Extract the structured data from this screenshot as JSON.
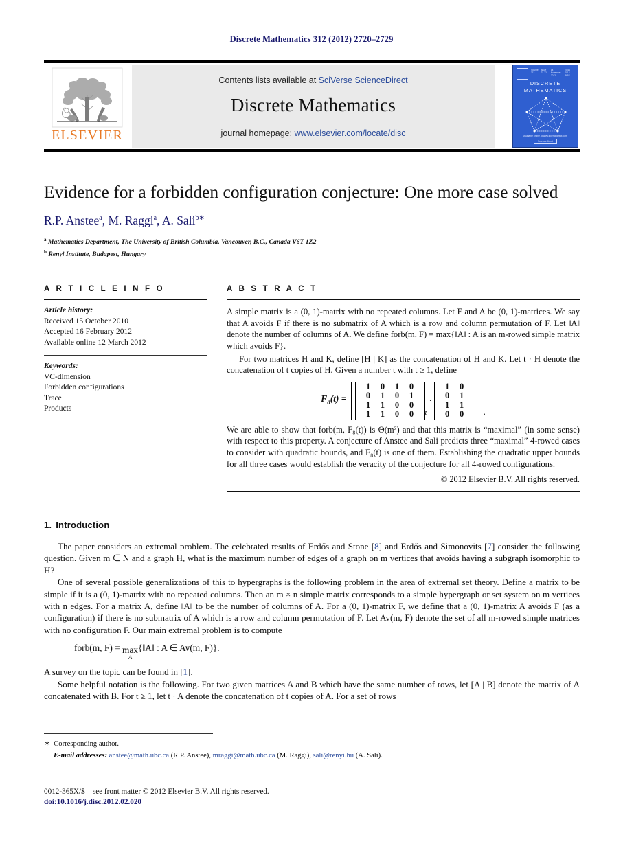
{
  "running_head": "Discrete Mathematics 312 (2012) 2720–2729",
  "masthead": {
    "contents_prefix": "Contents lists available at ",
    "contents_link": "SciVerse ScienceDirect",
    "journal_title": "Discrete Mathematics",
    "homepage_prefix": "journal homepage: ",
    "homepage_link": "www.elsevier.com/locate/disc",
    "publisher_wordmark": "ELSEVIER",
    "publisher_color": "#E87722"
  },
  "cover": {
    "title_line1": "DISCRETE",
    "title_line2": "MATHEMATICS",
    "header_items": [
      "Volume 312",
      "Issue 21-22",
      "14 November 2012",
      "ISSN 0012-365X"
    ],
    "footer_note": "Available online at www.sciencedirect.com",
    "footer_badge": "ScienceDirect",
    "background_color": "#2f5fd0"
  },
  "article": {
    "title": "Evidence for a forbidden configuration conjecture: One more case solved",
    "authors": [
      {
        "name": "R.P. Anstee",
        "marks": "a"
      },
      {
        "name": "M. Raggi",
        "marks": "a"
      },
      {
        "name": "A. Sali",
        "marks": "b∗"
      }
    ],
    "author_color": "#1a1a6e",
    "affiliations": [
      {
        "mark": "a",
        "text": "Mathematics Department, The University of British Columbia, Vancouver, B.C., Canada V6T 1Z2"
      },
      {
        "mark": "b",
        "text": "Renyi Institute, Budapest, Hungary"
      }
    ]
  },
  "info": {
    "heading": "A R T I C L E   I N F O",
    "history_label": "Article history:",
    "history": [
      "Received 15 October 2010",
      "Accepted 16 February 2012",
      "Available online 12 March 2012"
    ],
    "keywords_label": "Keywords:",
    "keywords": [
      "VC-dimension",
      "Forbidden configurations",
      "Trace",
      "Products"
    ]
  },
  "abstract": {
    "heading": "A B S T R A C T",
    "para1": "A simple matrix is a (0, 1)-matrix with no repeated columns. Let F and A be (0, 1)-matrices. We say that A avoids F if there is no submatrix of A which is a row and column permutation of F. Let ‖A‖ denote the number of columns of A. We define forb(m, F) = max{‖A‖ : A is an m-rowed simple matrix which avoids F}.",
    "para2": "For two matrices H and K, define [H | K] as the concatenation of H and K. Let t · H denote the concatenation of t copies of H. Given a number t with t ≥ 1, define",
    "equation": {
      "lead": "F",
      "lead_sub": "8",
      "lead_arg": "(t) =",
      "left_matrix": [
        [
          1,
          0,
          1,
          0
        ],
        [
          0,
          1,
          0,
          1
        ],
        [
          1,
          1,
          0,
          0
        ],
        [
          1,
          1,
          0,
          0
        ]
      ],
      "exponent": "t",
      "operator": "·",
      "right_matrix": [
        [
          1,
          0
        ],
        [
          0,
          1
        ],
        [
          1,
          1
        ],
        [
          0,
          0
        ]
      ],
      "tail": "."
    },
    "para3": "We are able to show that forb(m, F₈(t)) is Θ(m²) and that this matrix is “maximal” (in some sense) with respect to this property. A conjecture of Anstee and Sali predicts three “maximal” 4-rowed cases to consider with quadratic bounds, and F₈(t) is one of them. Establishing the quadratic upper bounds for all three cases would establish the veracity of the conjecture for all 4-rowed configurations.",
    "copyright": "© 2012 Elsevier B.V. All rights reserved."
  },
  "introduction": {
    "number": "1.",
    "heading": "Introduction",
    "para1_a": "The paper considers an extremal problem. The celebrated results of  Erdős and Stone [",
    "cite1": "8",
    "para1_b": "] and Erdős and Simonovits [",
    "cite2": "7",
    "para1_c": "] consider the following question. Given m ∈ N and a graph H, what is the maximum number of edges of a graph on m vertices that avoids having a subgraph isomorphic to H?",
    "para2": "One of several possible generalizations of this to hypergraphs is the following problem in the area of extremal set theory. Define a matrix to be simple if it is a (0, 1)-matrix with no repeated columns. Then an m × n simple matrix corresponds to a simple hypergraph or set system on m vertices with n edges. For a matrix A, define ‖A‖ to be the number of columns of A. For a (0, 1)-matrix F, we define that a (0, 1)-matrix A avoids F (as a configuration) if there is no submatrix of A which is a row and column permutation of F. Let Av(m, F) denote the set of all m-rowed simple matrices with no configuration F. Our main extremal problem is to compute",
    "equation_lhs": "forb(m, F) =",
    "equation_max": "max",
    "equation_max_sub": "A",
    "equation_rhs": "{‖A‖ : A ∈ Av(m, F)}.",
    "para3_a": "A survey on the topic can be found in [",
    "cite3": "1",
    "para3_b": "].",
    "para4": "Some helpful notation is the following. For two given matrices A and B which have the same number of rows, let [A | B] denote the matrix of A concatenated with B. For t ≥ 1, let t · A denote the concatenation of t copies of A. For a set of rows"
  },
  "footnotes": {
    "corresponding_mark": "∗",
    "corresponding_text": "Corresponding author.",
    "email_label": "E-mail addresses:",
    "emails": [
      {
        "address": "anstee@math.ubc.ca",
        "owner": " (R.P. Anstee), "
      },
      {
        "address": "mraggi@math.ubc.ca",
        "owner": " (M. Raggi), "
      },
      {
        "address": "sali@renyi.hu",
        "owner": " (A. Sali)."
      }
    ]
  },
  "imprint": {
    "line1": "0012-365X/$ – see front matter © 2012 Elsevier B.V. All rights reserved.",
    "doi": "doi:10.1016/j.disc.2012.02.020"
  }
}
